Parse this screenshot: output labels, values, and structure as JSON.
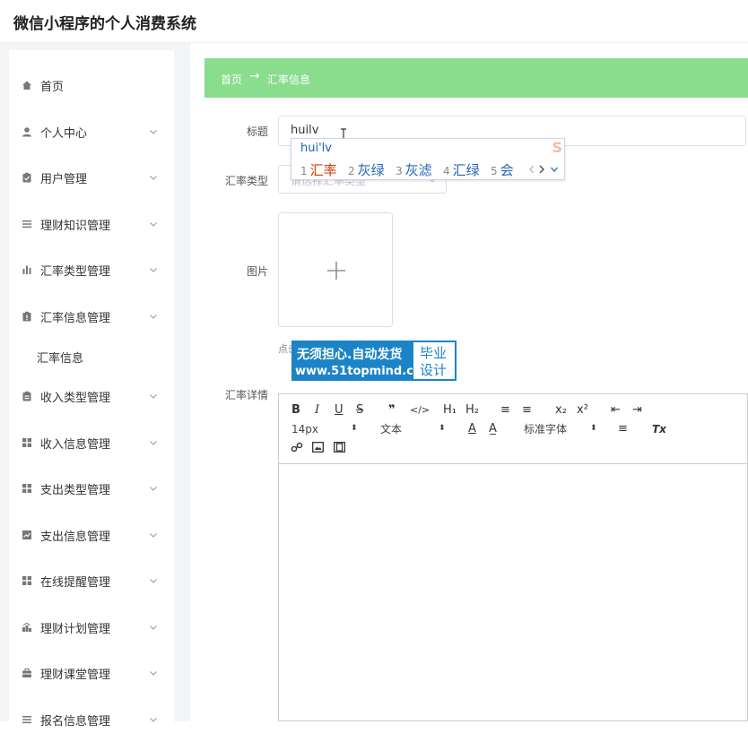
{
  "app": {
    "title": "微信小程序的个人消费系统"
  },
  "sidebar": {
    "items": [
      {
        "label": "首页",
        "icon": "home-icon"
      },
      {
        "label": "个人中心",
        "icon": "user-icon"
      },
      {
        "label": "用户管理",
        "icon": "clipboard-icon"
      },
      {
        "label": "理财知识管理",
        "icon": "list-icon"
      },
      {
        "label": "汇率类型管理",
        "icon": "bar-chart-icon"
      },
      {
        "label": "汇率信息管理",
        "icon": "clipboard-icon"
      },
      {
        "label": "收入类型管理",
        "icon": "clipboard-icon"
      },
      {
        "label": "收入信息管理",
        "icon": "grid-icon"
      },
      {
        "label": "支出类型管理",
        "icon": "grid-icon"
      },
      {
        "label": "支出信息管理",
        "icon": "line-chart-icon"
      },
      {
        "label": "在线提醒管理",
        "icon": "grid-icon"
      },
      {
        "label": "理财计划管理",
        "icon": "chart-icon"
      },
      {
        "label": "理财课堂管理",
        "icon": "briefcase-icon"
      },
      {
        "label": "报名信息管理",
        "icon": "list-icon"
      }
    ],
    "submenu": {
      "label": "汇率信息"
    }
  },
  "breadcrumb": {
    "home": "首页",
    "arrow": "→",
    "current": "汇率信息"
  },
  "form": {
    "title_label": "标题",
    "title_value": "huilv",
    "type_label": "汇率类型",
    "type_placeholder": "请选择汇率类型",
    "image_label": "图片",
    "detail_label": "汇率详情",
    "upload_hint": "点击"
  },
  "ime": {
    "composition": "hui'lv",
    "candidates": [
      {
        "num": "1",
        "text": "汇率"
      },
      {
        "num": "2",
        "text": "灰绿"
      },
      {
        "num": "3",
        "text": "灰滤"
      },
      {
        "num": "4",
        "text": "汇绿"
      },
      {
        "num": "5",
        "text": "会"
      }
    ],
    "logo": "S"
  },
  "watermark": {
    "line1": "无须担心.自动发货",
    "line2": "www.51topmind.com",
    "right1": "毕业",
    "right2": "设计"
  },
  "editor": {
    "bold": "B",
    "italic": "I",
    "underline": "U",
    "strike": "S",
    "quote": "❞",
    "code": "</>",
    "h1": "H₁",
    "h2": "H₂",
    "ordered": "≡",
    "bullet": "≡",
    "sub": "x₂",
    "sup": "x²",
    "outdent": "⇤",
    "indent": "⇥",
    "size": "14px",
    "paragraph": "文本",
    "font": "标准字体",
    "color": "A",
    "bg": "A̲",
    "align": "≡",
    "clean": "Tx",
    "link": "🔗",
    "image": "▣",
    "video": "▦"
  },
  "colors": {
    "accent": "#89dd8d",
    "watermark": "#1c84c6",
    "ime_first": "#d83b01"
  }
}
